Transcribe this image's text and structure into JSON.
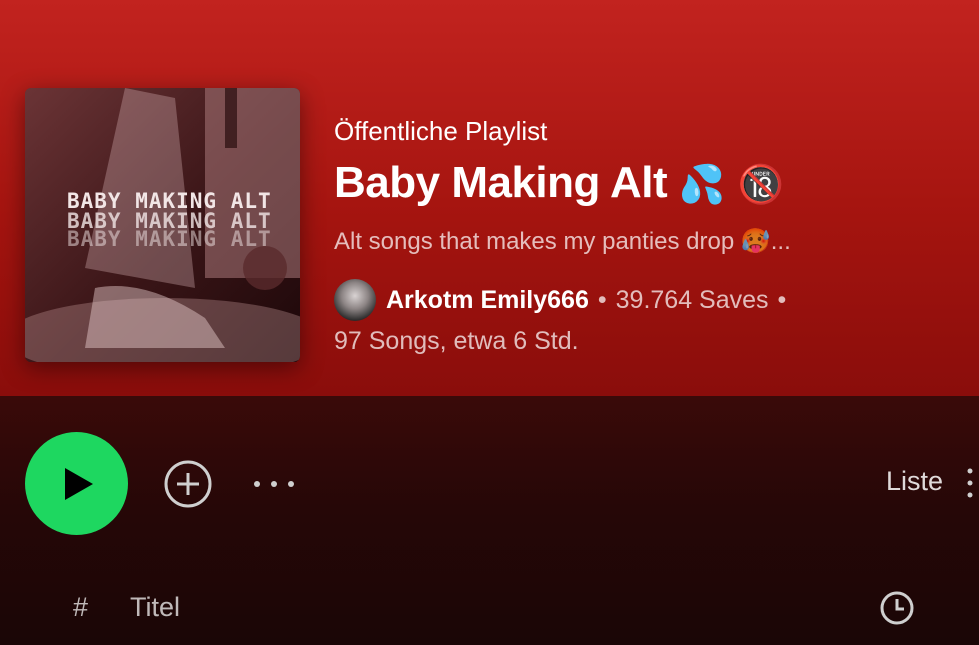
{
  "playlist": {
    "type_label": "Öffentliche Playlist",
    "title": "Baby Making Alt",
    "title_emojis": "💦 🔞",
    "description": "Alt songs that makes my panties drop 🥵...",
    "owner": "Arkotm Emily666",
    "saves": "39.764 Saves",
    "separator": "•",
    "stats": "97 Songs, etwa 6 Std.",
    "cover_text": [
      "BABY MAKING ALT",
      "BABY MAKING ALT",
      "BABY MAKING ALT"
    ]
  },
  "actions": {
    "view_label": "Liste"
  },
  "table": {
    "index_header": "#",
    "title_header": "Titel"
  },
  "colors": {
    "header_top": "#c2231f",
    "header_bottom": "#8a0d0b",
    "play_button": "#1ed760",
    "background": "#1a0606"
  },
  "icons": {
    "play": "play-icon",
    "add": "add-circle-icon",
    "more": "more-horizontal-icon",
    "list_menu": "more-vertical-icon",
    "duration": "clock-icon"
  }
}
